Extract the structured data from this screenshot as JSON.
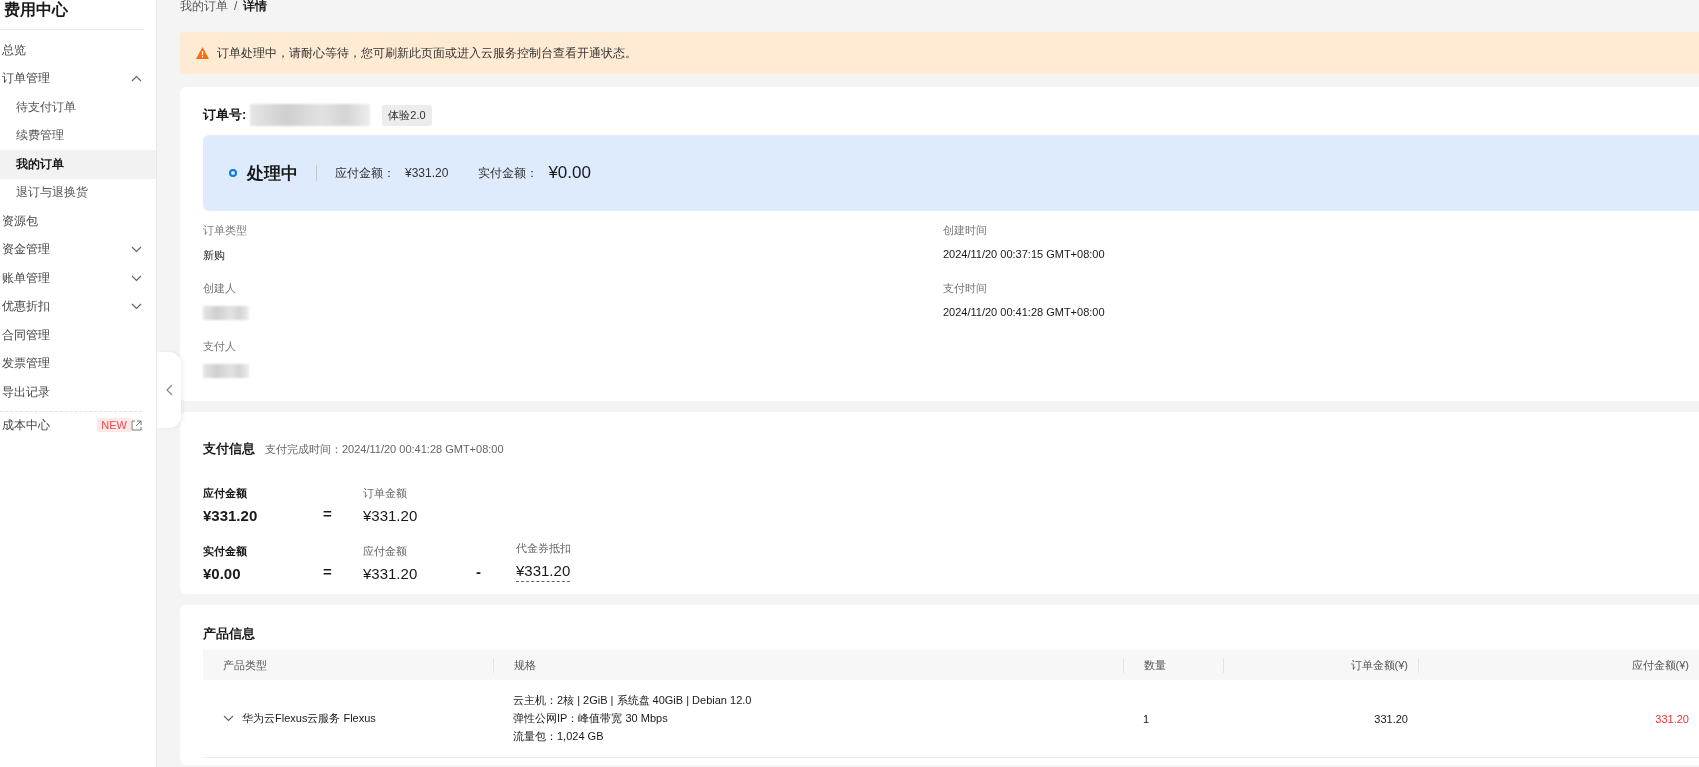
{
  "sidebar": {
    "title": "费用中心",
    "items": [
      {
        "label": "总览",
        "selected": false
      },
      {
        "label": "订单管理",
        "selected": false,
        "expanded": true,
        "children": [
          {
            "label": "待支付订单",
            "selected": false
          },
          {
            "label": "续费管理",
            "selected": false
          },
          {
            "label": "我的订单",
            "selected": true
          },
          {
            "label": "退订与退换货",
            "selected": false
          }
        ]
      },
      {
        "label": "资源包",
        "selected": false
      },
      {
        "label": "资金管理",
        "selected": false,
        "expanded": false
      },
      {
        "label": "账单管理",
        "selected": false,
        "expanded": false
      },
      {
        "label": "优惠折扣",
        "selected": false,
        "expanded": false
      },
      {
        "label": "合同管理",
        "selected": false
      },
      {
        "label": "发票管理",
        "selected": false
      },
      {
        "label": "导出记录",
        "selected": false
      },
      {
        "label": "成本中心",
        "selected": false,
        "badge": "NEW",
        "external": true
      }
    ]
  },
  "breadcrumb": {
    "separator": "/",
    "items": [
      "我的订单",
      "详情"
    ]
  },
  "alert": {
    "text": "订单处理中，请耐心等待，您可刷新此页面或进入云服务控制台查看开通状态。"
  },
  "order": {
    "number_label": "订单号:",
    "tag": "体验2.0",
    "status": "处理中",
    "payable_label": "应付金额：",
    "payable": "¥331.20",
    "paid_label": "实付金额：",
    "paid": "¥0.00",
    "fields": [
      {
        "label": "订单类型",
        "value": "新购"
      },
      {
        "label": "创建时间",
        "value": "2024/11/20 00:37:15 GMT+08:00"
      },
      {
        "label": "创建人"
      },
      {
        "label": "支付时间",
        "value": "2024/11/20 00:41:28 GMT+08:00"
      },
      {
        "label": "支付人"
      }
    ]
  },
  "payment": {
    "title": "支付信息",
    "subtitle": "支付完成时间：2024/11/20 00:41:28 GMT+08:00",
    "rows": [
      {
        "items": [
          {
            "label": "应付金额",
            "value": "¥331.20",
            "strong": true
          },
          {
            "op": "="
          },
          {
            "label": "订单金额",
            "value": "¥331.20"
          }
        ]
      },
      {
        "items": [
          {
            "label": "实付金额",
            "value": "¥0.00",
            "strong": true
          },
          {
            "op": "="
          },
          {
            "label": "应付金额",
            "value": "¥331.20"
          },
          {
            "op": "-"
          },
          {
            "label": "代金券抵扣",
            "value": "¥331.20",
            "dashed": true
          }
        ]
      }
    ]
  },
  "products": {
    "title": "产品信息",
    "columns": [
      "产品类型",
      "规格",
      "数量",
      "订单金额(¥)",
      "应付金额(¥)"
    ],
    "rows": [
      {
        "expanded": false,
        "name": "华为云Flexus云服务 Flexus",
        "specs": [
          "云主机：2核 | 2GiB | 系统盘 40GiB | Debian 12.0",
          "弹性公网IP：峰值带宽 30 Mbps",
          "流量包：1,024 GB"
        ],
        "quantity": "1",
        "order_amount": "331.20",
        "payable": "331.20"
      }
    ]
  }
}
